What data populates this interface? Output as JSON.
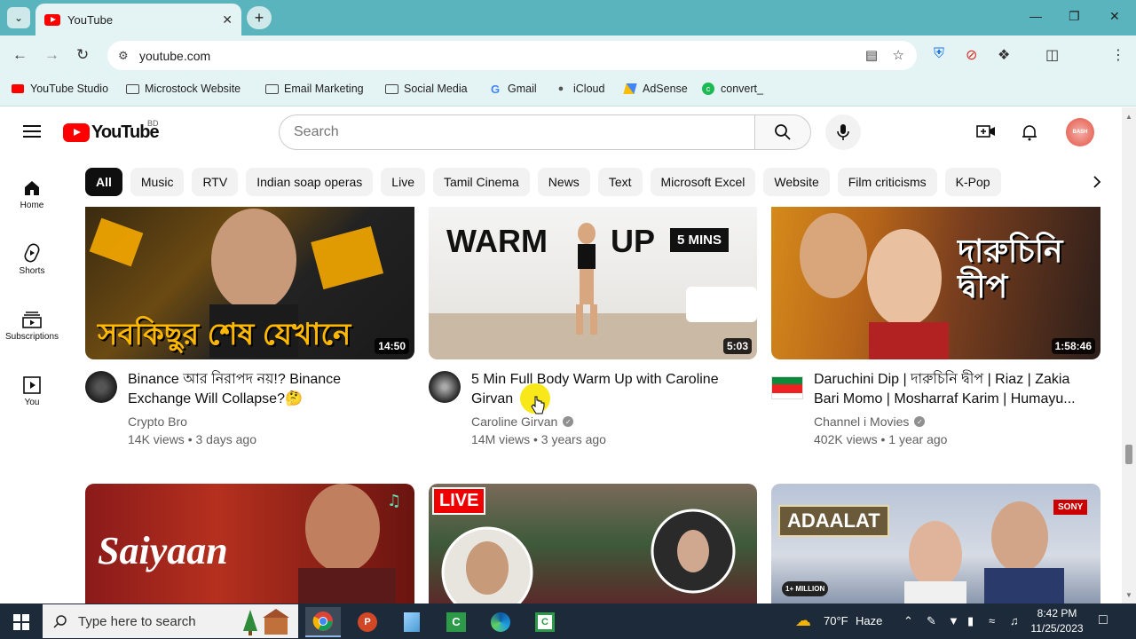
{
  "browser": {
    "tab_title": "YouTube",
    "url": "youtube.com",
    "bookmarks": [
      {
        "label": "YouTube Studio",
        "icon": "youtube-studio-icon"
      },
      {
        "label": "Microstock Website",
        "icon": "folder-icon"
      },
      {
        "label": "Email Marketing",
        "icon": "folder-icon"
      },
      {
        "label": "Social Media",
        "icon": "folder-icon"
      },
      {
        "label": "Gmail",
        "icon": "google-icon"
      },
      {
        "label": "iCloud",
        "icon": "apple-icon"
      },
      {
        "label": "AdSense",
        "icon": "adsense-icon"
      },
      {
        "label": "convert_",
        "icon": "convert-icon"
      }
    ]
  },
  "youtube": {
    "country_code": "BD",
    "search_placeholder": "Search",
    "avatar_text": "BASH",
    "sidebar": [
      {
        "label": "Home",
        "icon": "home-icon"
      },
      {
        "label": "Shorts",
        "icon": "shorts-icon"
      },
      {
        "label": "Subscriptions",
        "icon": "subscriptions-icon"
      },
      {
        "label": "You",
        "icon": "you-icon"
      }
    ],
    "chips": [
      "All",
      "Music",
      "RTV",
      "Indian soap operas",
      "Live",
      "Tamil Cinema",
      "News",
      "Text",
      "Microsoft Excel",
      "Website",
      "Film criticisms",
      "K-Pop"
    ],
    "videos": [
      {
        "title": "Binance আর নিরাপদ নয়!? Binance Exchange Will Collapse?🤔",
        "channel": "Crypto Bro",
        "verified": false,
        "meta": "14K views • 3 days ago",
        "duration": "14:50",
        "thumb_text": "সবকিছুর শেষ যেখানে"
      },
      {
        "title": "5 Min Full Body Warm Up with Caroline Girvan",
        "channel": "Caroline Girvan",
        "verified": true,
        "meta": "14M views • 3 years ago",
        "duration": "5:03",
        "thumb_text_left": "WARM",
        "thumb_text_right": "UP",
        "thumb_badge": "5 MINS"
      },
      {
        "title": "Daruchini Dip | দারুচিনি দ্বীপ | Riaz | Zakia Bari Momo | Mosharraf Karim | Humayu...",
        "channel": "Channel i Movies",
        "verified": true,
        "meta": "402K views • 1 year ago",
        "duration": "1:58:46",
        "thumb_text": "দারুচিনি দ্বীপ"
      },
      {
        "thumb_text": "Saiyaan"
      },
      {
        "thumb_badge": "LIVE"
      },
      {
        "thumb_text": "ADAALAT",
        "thumb_badge": "SONY",
        "thumb_badge2": "1+ MILLION"
      }
    ]
  },
  "taskbar": {
    "search_placeholder": "Type here to search",
    "weather": "70°F",
    "weather_desc": "Haze",
    "time": "8:42 PM",
    "date": "11/25/2023"
  },
  "colors": {
    "accent_red": "#ff0000",
    "tabbar": "#5ab4bd",
    "chrome_bg": "#e4f3f4",
    "taskbar": "#1c2a3a"
  }
}
